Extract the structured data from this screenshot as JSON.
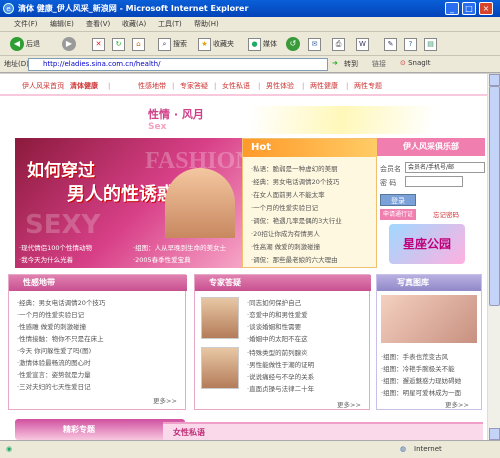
{
  "window": {
    "title": "清体 健康_伊人风采_新浪网 - Microsoft Internet Explorer"
  },
  "menu": [
    "文件(F)",
    "编辑(E)",
    "查看(V)",
    "收藏(A)",
    "工具(T)",
    "帮助(H)"
  ],
  "toolbar": {
    "back": "后退",
    "search": "搜索",
    "favorites": "收藏夹",
    "media": "媒体"
  },
  "address": {
    "label": "地址(D)",
    "url": "http://eladies.sina.com.cn/health/",
    "go": "转到",
    "links": "链接",
    "snagit": "SnagIt"
  },
  "site_nav": [
    "伊人风采首页",
    "清体健康",
    "性感地带",
    "专家答疑",
    "女性私语",
    "男性体验",
    "两性健康",
    "两性专题"
  ],
  "brand": {
    "cn": "性情 · 风月",
    "en": "Sex"
  },
  "hero": {
    "title1": "如何穿过",
    "title2": "男人的性诱惑",
    "fashion": "FASHION",
    "sexy": "SEXY",
    "links": [
      "·现代情侣100个性情动物",
      "·组图：人从早晚到生命的美女士",
      "·我今天为什么光着",
      "·2005春季性爱宝典"
    ]
  },
  "hot": {
    "title": "Hot",
    "items": [
      "·私语：脆弱是一种虚幻的美丽",
      "·经典：男女电话调情20个技巧",
      "·在女人面前男人不能太率",
      "·一个月的性爱实验日记",
      "·调侃：艳遇几率是偶的3大行业",
      "·20招让你成为有情男人",
      "·性高潮 做爱的刺激碰撞",
      "·调侃：那些最老娘的六大理由"
    ]
  },
  "club": {
    "title": "伊人风采俱乐部",
    "member_label": "会员名",
    "member_value": "会员名/手机号/邮",
    "password_label": "密 码",
    "login": "登录",
    "apply": "申请通行证",
    "forgot": "忘记密码",
    "promo": "星座公园"
  },
  "sex_zone": {
    "title": "性感地带",
    "items": [
      "·经典：男女电话调情20个技巧",
      "·一个月的性爱实验日记",
      "·性感雕 做爱的刺激碰撞",
      "·性情接触：物你不只是在床上",
      "·今天 你问躲性爱了吗(图)",
      "·激情体验最畅流的图心时",
      "·性爱宣言：姿势就是力量",
      "·三对夫妇的七天性爱日记"
    ],
    "more": "更多>>"
  },
  "expert": {
    "title": "专家答疑",
    "items": [
      "·同志如何保护自己",
      "·恋爱中的和男性爱爱",
      "·谈谈婚姻和性需要",
      "·婚姻中的太阳不在这",
      "·特殊类型的前列腺炎",
      "·男性能做性于潮的证明",
      "·说说痛经与不孕的关系",
      "·直面贞操与法律二十年"
    ],
    "more": "更多>>"
  },
  "gallery": {
    "title": "写真图库",
    "items": [
      "·组图：手表也荒变古风",
      "·组图：冷艳手腕极关不能",
      "·组图：邂逅魅惑力现妨碍她",
      "·组图：明星可爱林成为一面"
    ],
    "more": "更多>>"
  },
  "bottom": {
    "special": "精彩专题",
    "private": "女性私语"
  },
  "status": {
    "zone": "Internet"
  }
}
